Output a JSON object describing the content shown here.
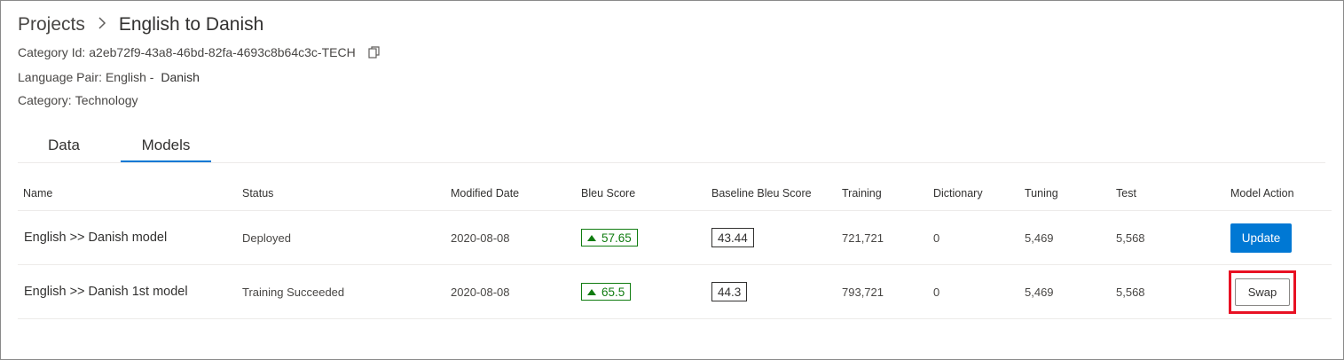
{
  "breadcrumb": {
    "root": "Projects",
    "current": "English to Danish"
  },
  "meta": {
    "category_id_label": "Category Id:",
    "category_id": "a2eb72f9-43a8-46bd-82fa-4693c8b64c3c-TECH",
    "language_pair_label": "Language Pair:",
    "language_pair_source": "English -",
    "language_pair_target": "Danish",
    "category_label": "Category:",
    "category": "Technology"
  },
  "tabs": [
    {
      "label": "Data",
      "active": false
    },
    {
      "label": "Models",
      "active": true
    }
  ],
  "table": {
    "headers": [
      "Name",
      "Status",
      "Modified Date",
      "Bleu Score",
      "Baseline Bleu Score",
      "Training",
      "Dictionary",
      "Tuning",
      "Test",
      "Model Action"
    ],
    "rows": [
      {
        "name": "English >> Danish  model",
        "status": "Deployed",
        "modified": "2020-08-08",
        "bleu": "57.65",
        "baseline": "43.44",
        "training": "721,721",
        "dictionary": "0",
        "tuning": "5,469",
        "test": "5,568",
        "action": "Update"
      },
      {
        "name": "English >> Danish 1st model",
        "status": "Training Succeeded",
        "modified": "2020-08-08",
        "bleu": "65.5",
        "baseline": "44.3",
        "training": "793,721",
        "dictionary": "0",
        "tuning": "5,469",
        "test": "5,568",
        "action": "Swap"
      }
    ]
  },
  "colors": {
    "accent": "#0078d4",
    "positive": "#107c10",
    "highlight": "#e81123"
  },
  "icons": {
    "copy": "copy-icon",
    "chevron": "chevron-right-icon",
    "trend_up": "triangle-up-icon"
  }
}
